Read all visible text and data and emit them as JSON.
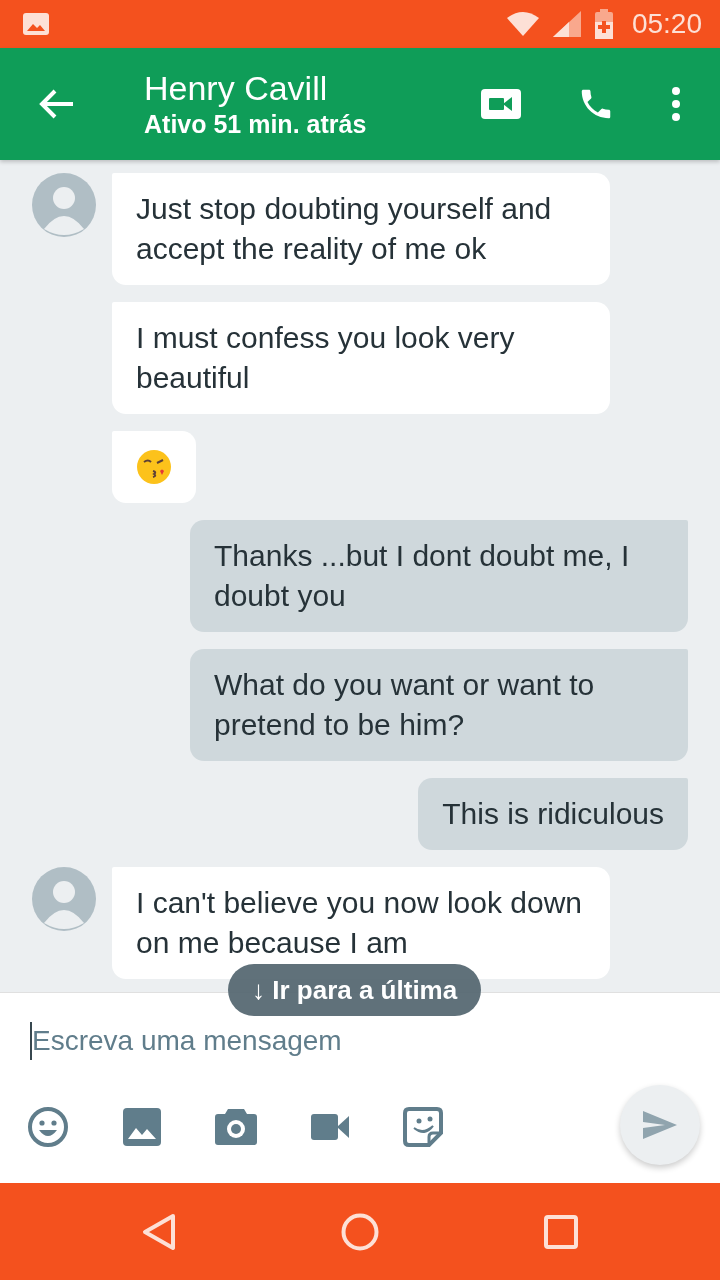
{
  "status_bar": {
    "time": "05:20"
  },
  "app_bar": {
    "title": "Henry Cavill",
    "subtitle": "Ativo 51 min. atrás"
  },
  "messages": [
    {
      "kind": "incoming",
      "avatar": true,
      "text": "Just stop doubting yourself and accept the reality of me ok"
    },
    {
      "kind": "incoming",
      "avatar": false,
      "text": "I must confess you look very beautiful"
    },
    {
      "kind": "emoji",
      "avatar": false
    },
    {
      "kind": "outgoing",
      "text": "Thanks ...but I dont doubt me, I doubt you"
    },
    {
      "kind": "outgoing",
      "text": "What do you want or want to pretend to be him?"
    },
    {
      "kind": "outgoing",
      "text": "This is ridiculous"
    },
    {
      "kind": "incoming",
      "avatar": true,
      "text": "I can't believe you now look down on me because I am"
    }
  ],
  "jump_button": {
    "label": "↓ Ir para a última"
  },
  "composer": {
    "placeholder": "Escreva uma mensagem"
  }
}
